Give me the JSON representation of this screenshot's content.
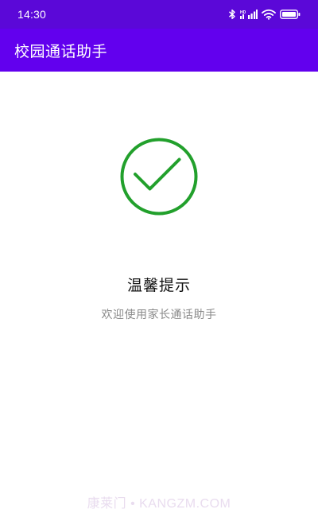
{
  "status_bar": {
    "time": "14:30",
    "icons": [
      "bluetooth-icon",
      "hd-signal-icon",
      "wifi-icon",
      "battery-icon"
    ],
    "background": "#5b08d8"
  },
  "app_bar": {
    "title": "校园通话助手",
    "background": "#6200ee"
  },
  "message": {
    "icon": "check-circle-icon",
    "icon_color": "#22a02c",
    "title": "温馨提示",
    "subtitle": "欢迎使用家长通话助手"
  },
  "watermark": {
    "text": "康莱门 • KANGZM.COM"
  }
}
